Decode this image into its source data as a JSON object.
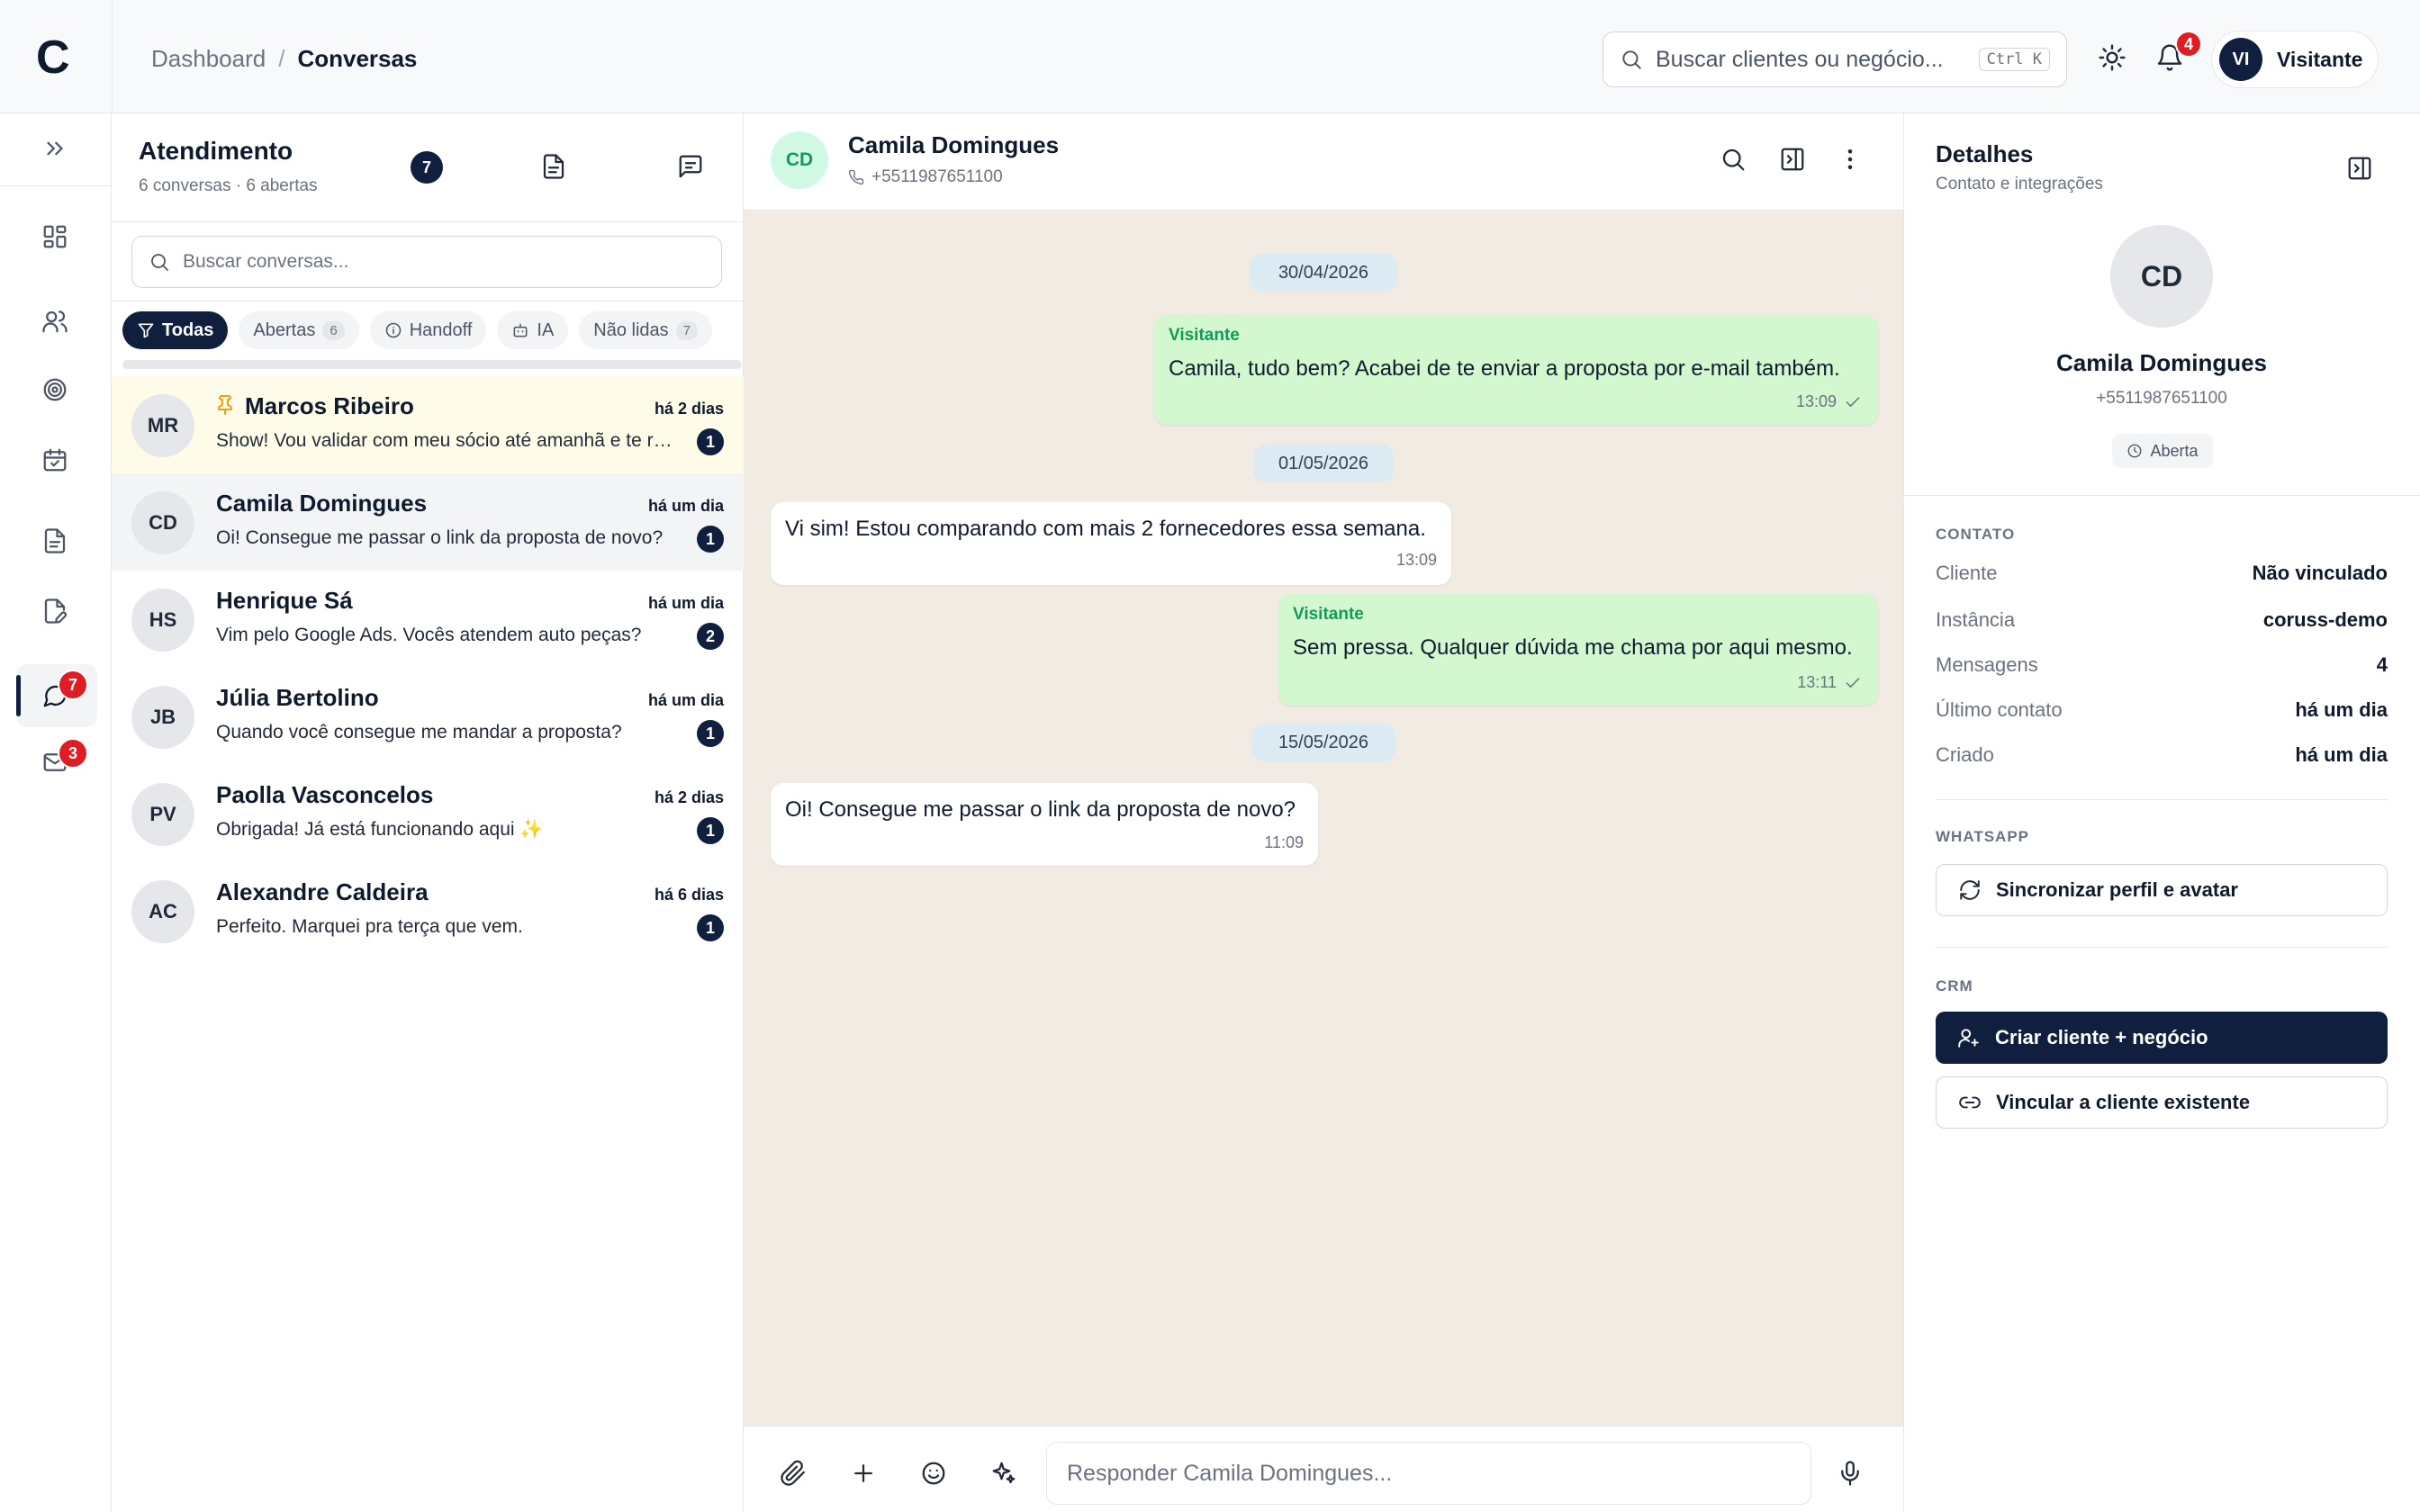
{
  "app": {
    "logo_letter": "C"
  },
  "breadcrumb": {
    "root": "Dashboard",
    "separator": "/",
    "current": "Conversas"
  },
  "search": {
    "placeholder": "Buscar clientes ou negócio...",
    "shortcut": "Ctrl K"
  },
  "notifications": {
    "count": "4"
  },
  "user": {
    "initials": "VI",
    "name": "Visitante"
  },
  "rail": {
    "chat_badge": "7",
    "mail_badge": "3"
  },
  "list": {
    "title": "Atendimento",
    "subtitle": "6 conversas · 6 abertas",
    "badge": "7",
    "search_placeholder": "Buscar conversas...",
    "filters": [
      {
        "label": "Todas"
      },
      {
        "label": "Abertas",
        "count": "6"
      },
      {
        "label": "Handoff"
      },
      {
        "label": "IA"
      },
      {
        "label": "Não lidas",
        "count": "7"
      }
    ],
    "items": [
      {
        "initials": "MR",
        "name": "Marcos Ribeiro",
        "time": "há 2 dias",
        "preview": "Show! Vou validar com meu sócio até amanhã e te retorno",
        "unread": "1",
        "pinned": true
      },
      {
        "initials": "CD",
        "name": "Camila Domingues",
        "time": "há um dia",
        "preview": "Oi! Consegue me passar o link da proposta de novo?",
        "unread": "1"
      },
      {
        "initials": "HS",
        "name": "Henrique Sá",
        "time": "há um dia",
        "preview": "Vim pelo Google Ads. Vocês atendem auto peças?",
        "unread": "2"
      },
      {
        "initials": "JB",
        "name": "Júlia Bertolino",
        "time": "há um dia",
        "preview": "Quando você consegue me mandar a proposta?",
        "unread": "1"
      },
      {
        "initials": "PV",
        "name": "Paolla Vasconcelos",
        "time": "há 2 dias",
        "preview": "Obrigada! Já está funcionando aqui ✨",
        "unread": "1"
      },
      {
        "initials": "AC",
        "name": "Alexandre Caldeira",
        "time": "há 6 dias",
        "preview": "Perfeito. Marquei pra terça que vem.",
        "unread": "1"
      }
    ]
  },
  "chat": {
    "initials": "CD",
    "name": "Camila Domingues",
    "phone": "+5511987651100",
    "dates": [
      "30/04/2026",
      "01/05/2026",
      "15/05/2026"
    ],
    "messages": [
      {
        "sender": "Visitante",
        "text": "Camila, tudo bem? Acabei de te enviar a proposta por e-mail também.",
        "time": "13:09"
      },
      {
        "text": "Vi sim! Estou comparando com mais 2 fornecedores essa semana.",
        "time": "13:09"
      },
      {
        "sender": "Visitante",
        "text": "Sem pressa. Qualquer dúvida me chama por aqui mesmo.",
        "time": "13:11"
      },
      {
        "text": "Oi! Consegue me passar o link da proposta de novo?",
        "time": "11:09"
      }
    ],
    "reply_placeholder": "Responder Camila Domingues..."
  },
  "details": {
    "title": "Detalhes",
    "subtitle": "Contato e integrações",
    "initials": "CD",
    "name": "Camila Domingues",
    "phone": "+5511987651100",
    "status": "Aberta",
    "contact_section": "CONTATO",
    "rows": [
      {
        "label": "Cliente",
        "value": "Não vinculado"
      },
      {
        "label": "Instância",
        "value": "coruss-demo"
      },
      {
        "label": "Mensagens",
        "value": "4"
      },
      {
        "label": "Último contato",
        "value": "há um dia"
      },
      {
        "label": "Criado",
        "value": "há um dia"
      }
    ],
    "whatsapp_section": "WHATSAPP",
    "sync_label": "Sincronizar perfil e avatar",
    "crm_section": "CRM",
    "create_label": "Criar cliente + negócio",
    "link_label": "Vincular a cliente existente"
  },
  "colors": {
    "navy": "#0f1f3d",
    "outgoing_bubble": "#d3f8d0",
    "chat_bg": "#f1ebe4",
    "badge_red": "#e11d24"
  }
}
